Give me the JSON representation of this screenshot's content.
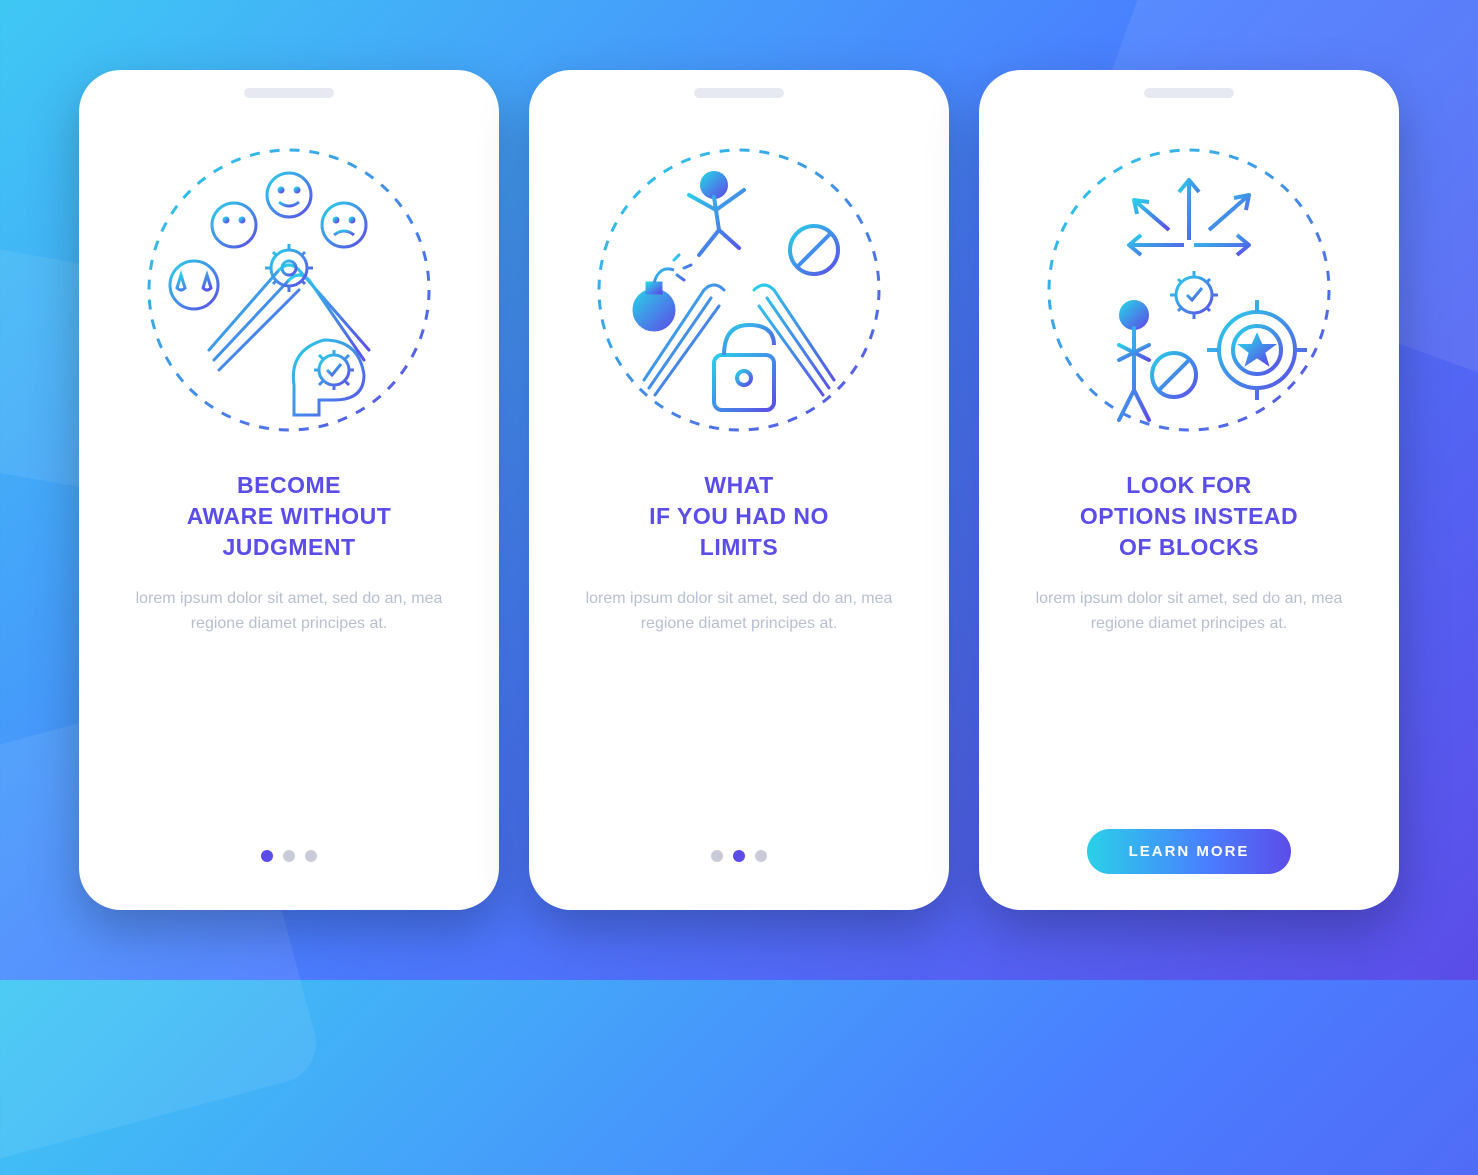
{
  "screens": [
    {
      "title": "BECOME\nAWARE WITHOUT\nJUDGMENT",
      "body": "lorem ipsum dolor sit amet, sed do an, mea regione diamet principes at.",
      "active_dot": 0,
      "has_cta": false
    },
    {
      "title": "WHAT\nIF YOU HAD NO\nLIMITS",
      "body": "lorem ipsum dolor sit amet, sed do an, mea regione diamet principes at.",
      "active_dot": 1,
      "has_cta": false
    },
    {
      "title": "LOOK FOR\nOPTIONS INSTEAD\nOF BLOCKS",
      "body": "lorem ipsum dolor sit amet, sed do an, mea regione diamet principes at.",
      "active_dot": 2,
      "has_cta": true
    }
  ],
  "cta_label": "LEARN MORE",
  "colors": {
    "accent": "#5b4de8",
    "muted": "#b8bfd0",
    "dot_inactive": "#c9ccd8",
    "gradient_start": "#2ad0e8",
    "gradient_end": "#5b4de8"
  }
}
